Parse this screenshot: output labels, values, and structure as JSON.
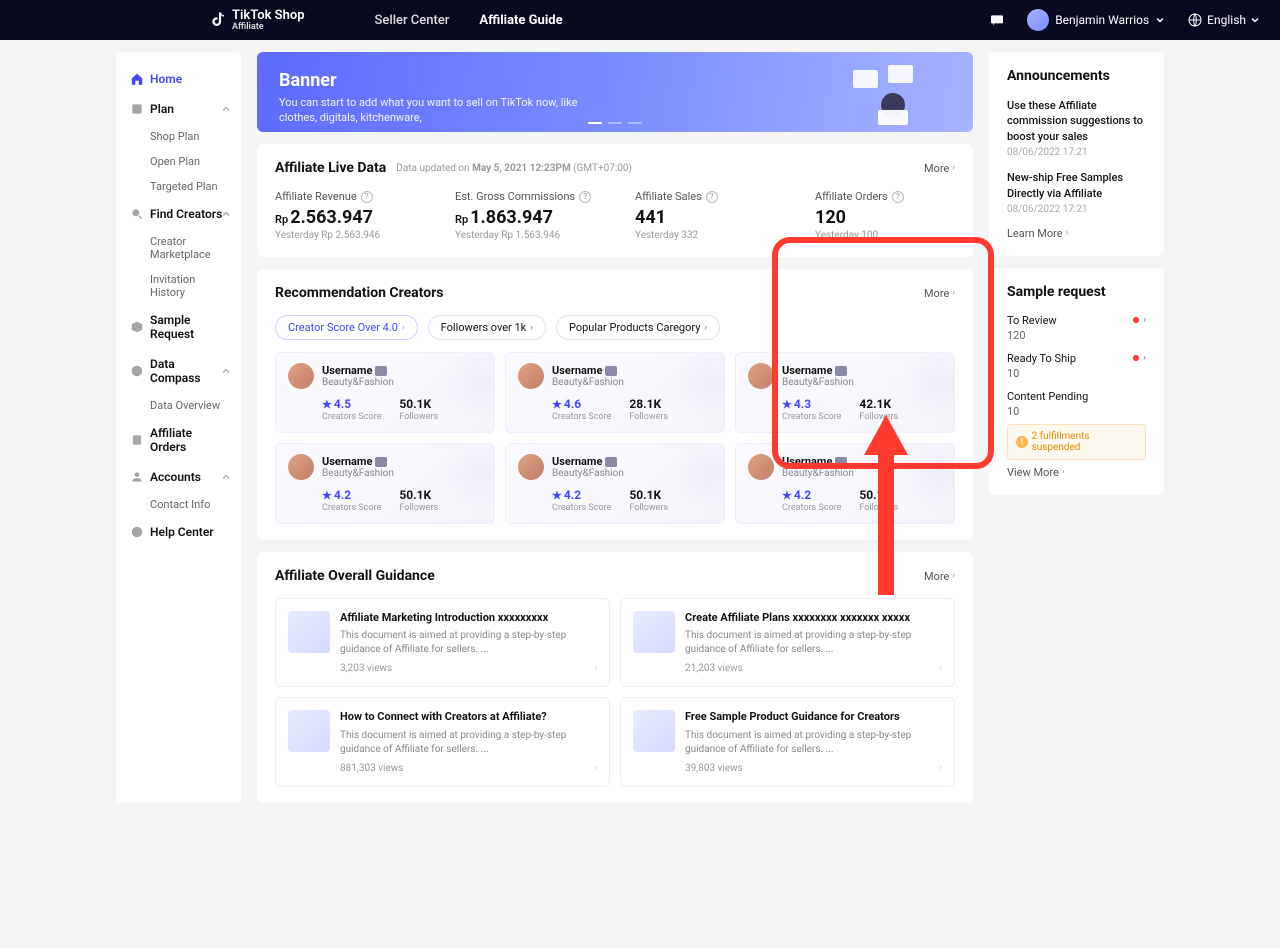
{
  "header": {
    "brand_main": "TikTok Shop",
    "brand_sub": "Affiliate",
    "nav1": "Seller Center",
    "nav2": "Affiliate Guide",
    "username": "Benjamin Warrios",
    "language": "English"
  },
  "sidebar": {
    "home": "Home",
    "plan": "Plan",
    "shop_plan": "Shop Plan",
    "open_plan": "Open Plan",
    "targeted_plan": "Targeted Plan",
    "find_creators": "Find Creators",
    "creator_marketplace": "Creator Marketplace",
    "invitation_history": "Invitation History",
    "sample_request": "Sample Request",
    "data_compass": "Data Compass",
    "data_overview": "Data Overview",
    "affiliate_orders": "Affiliate Orders",
    "accounts": "Accounts",
    "contact_info": "Contact Info",
    "help_center": "Help Center"
  },
  "banner": {
    "title": "Banner",
    "text": "You can start to add what you want to sell on TikTok now, like clothes, digitals, kitchenware,"
  },
  "livedata": {
    "title": "Affiliate Live Data",
    "updated_prefix": "Data updated on ",
    "updated_date": "May 5, 2021 12:23PM",
    "updated_tz": " (GMT+07:00)",
    "more": "More",
    "m1_label": "Affiliate Revenue",
    "m1_prefix": "Rp",
    "m1_value": "2.563.947",
    "m1_yest": "Yesterday Rp 2.563.946",
    "m2_label": "Est. Gross Commissions",
    "m2_prefix": "Rp",
    "m2_value": "1.863.947",
    "m2_yest": "Yesterday Rp 1.563.946",
    "m3_label": "Affiliate Sales",
    "m3_value": "441",
    "m3_yest": "Yesterday 332",
    "m4_label": "Affiliate Orders",
    "m4_value": "120",
    "m4_yest": "Yesterday 100"
  },
  "recs": {
    "title": "Recommendation Creators",
    "more": "More",
    "chip1": "Creator Score Over 4.0",
    "chip2": "Followers over 1k",
    "chip3": "Popular Products Caregory",
    "name": "Username",
    "cat": "Beauty&Fashion",
    "score_l": "Creators Score",
    "foll_l": "Followers",
    "s1": "4.5",
    "f1": "50.1K",
    "s2": "4.6",
    "f2": "28.1K",
    "s3": "4.3",
    "f3": "42.1K",
    "s4": "4.2",
    "f4": "50.1K",
    "s5": "4.2",
    "f5": "50.1K",
    "s6": "4.2",
    "f6": "50.1K"
  },
  "guidance": {
    "title": "Affiliate Overall Guidance",
    "more": "More",
    "g1_t": "Affiliate Marketing Introduction xxxxxxxxx",
    "g1_d": "This document is aimed at providing a step-by-step guidance of Affiliate for sellers. ...",
    "g1_v": "3,203 views",
    "g2_t": "Create Affiliate Plans xxxxxxxx xxxxxxx xxxxx",
    "g2_d": "This document is aimed at providing a step-by-step guidance of Affiliate for sellers. ...",
    "g2_v": "21,203 views",
    "g3_t": "How to Connect with Creators at Affiliate?",
    "g3_d": "This document is aimed at providing a step-by-step guidance of Affiliate for sellers. ...",
    "g3_v": "881,303 views",
    "g4_t": "Free Sample Product Guidance for Creators",
    "g4_d": "This document is aimed at providing a step-by-step guidance of Affiliate for sellers. ...",
    "g4_v": "39,803 views"
  },
  "ann": {
    "title": "Announcements",
    "a1_t": "Use these Affiliate commission suggestions to boost your sales",
    "a1_d": "08/06/2022 17:21",
    "a2_t": "New-ship Free Samples Directly via Affiliate",
    "a2_d": "08/06/2022 17:21",
    "learn": "Learn More"
  },
  "sample": {
    "title": "Sample request",
    "r1_l": "To Review",
    "r1_v": "120",
    "r2_l": "Ready To Ship",
    "r2_v": "10",
    "r3_l": "Content Pending",
    "r3_v": "10",
    "alert": "2 fulfillments suspended",
    "view": "View More"
  }
}
